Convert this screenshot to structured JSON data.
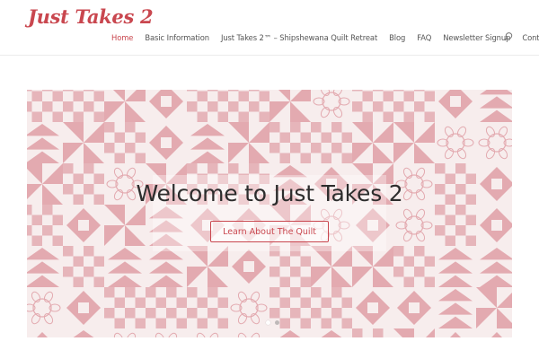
{
  "header": {
    "logo_text": "Just Takes 2"
  },
  "nav": {
    "items": [
      {
        "label": "Home",
        "active": true
      },
      {
        "label": "Basic Information",
        "active": false
      },
      {
        "label": "Just Takes 2™ – Shipshewana Quilt Retreat",
        "active": false
      },
      {
        "label": "Blog",
        "active": false
      },
      {
        "label": "FAQ",
        "active": false
      },
      {
        "label": "Newsletter Signup",
        "active": false
      },
      {
        "label": "Contact",
        "active": false
      }
    ],
    "search_icon": "search-icon"
  },
  "hero": {
    "title": "Welcome to Just Takes 2",
    "button_label": "Learn About The Quilt",
    "slides": 2,
    "active_slide": 1
  },
  "colors": {
    "accent": "#c9474f",
    "quilt_pink": "#e3aab0",
    "quilt_light": "#f7eded"
  }
}
